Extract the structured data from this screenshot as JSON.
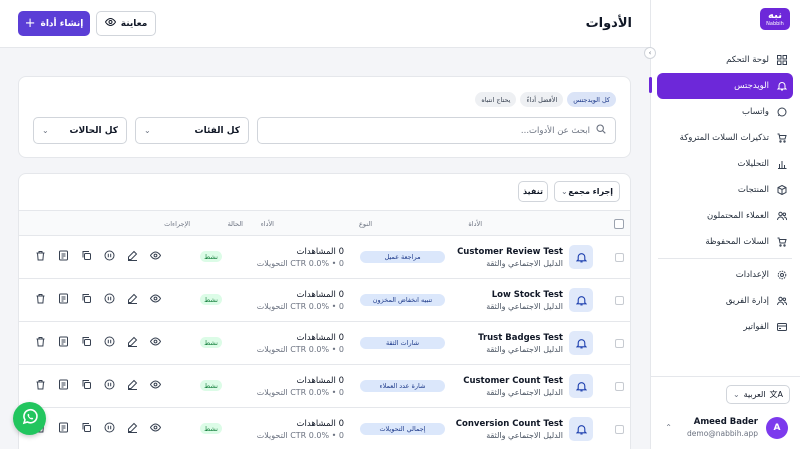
{
  "brand": {
    "logo_ar": "نبه",
    "logo_en": "Nabbih",
    "accent": "#6d28d9"
  },
  "header": {
    "title": "الأدوات",
    "create_label": "إنشاء أداة",
    "preview_label": "معاينة"
  },
  "sidebar": {
    "items": [
      {
        "label": "لوحة التحكم",
        "icon": "grid-icon"
      },
      {
        "label": "الويدجتس",
        "icon": "bell-icon",
        "active": true
      },
      {
        "label": "واتساب",
        "icon": "whatsapp-icon"
      },
      {
        "label": "تذكيرات السلات المتروكة",
        "icon": "cart-clock-icon"
      },
      {
        "label": "التحليلات",
        "icon": "bar-chart-icon"
      },
      {
        "label": "المنتجات",
        "icon": "box-icon"
      },
      {
        "label": "العملاء المحتملون",
        "icon": "users-icon"
      },
      {
        "label": "السلات المحفوظة",
        "icon": "cart-icon"
      },
      {
        "label": "الإعدادات",
        "icon": "gear-icon"
      },
      {
        "label": "إدارة الفريق",
        "icon": "team-icon"
      },
      {
        "label": "الفواتير",
        "icon": "invoice-icon"
      }
    ],
    "language": "العربية",
    "user": {
      "name": "Ameed Bader",
      "email": "demo@nabbih.app",
      "initial": "A"
    }
  },
  "filters": {
    "chips": [
      "كل الويدجتس",
      "الأفضل أداءً",
      "يحتاج انتباه"
    ],
    "search_placeholder": "ابحث عن الأدوات...",
    "category": "كل الفئات",
    "status": "كل الحالات"
  },
  "table": {
    "bulk_label": "إجراء مجمع",
    "execute_label": "تنفيذ",
    "columns": {
      "tool": "الأداة",
      "type": "النوع",
      "performance": "الأداء",
      "status": "الحالة",
      "actions": "الإجراءات"
    },
    "rows": [
      {
        "name": "Customer Review Test",
        "subtitle": "الدليل الاجتماعي والثقة",
        "type": "مراجعة عميل",
        "views": "0 المشاهدات",
        "ctr": "CTR 0.0% • 0 التحويلات",
        "status": "نشط"
      },
      {
        "name": "Low Stock Test",
        "subtitle": "الدليل الاجتماعي والثقة",
        "type": "تنبيه انخفاض المخزون",
        "views": "0 المشاهدات",
        "ctr": "CTR 0.0% • 0 التحويلات",
        "status": "نشط"
      },
      {
        "name": "Trust Badges Test",
        "subtitle": "الدليل الاجتماعي والثقة",
        "type": "شارات الثقة",
        "views": "0 المشاهدات",
        "ctr": "CTR 0.0% • 0 التحويلات",
        "status": "نشط"
      },
      {
        "name": "Customer Count Test",
        "subtitle": "الدليل الاجتماعي والثقة",
        "type": "شارة عدد العملاء",
        "views": "0 المشاهدات",
        "ctr": "CTR 0.0% • 0 التحويلات",
        "status": "نشط"
      },
      {
        "name": "Conversion Count Test",
        "subtitle": "الدليل الاجتماعي والثقة",
        "type": "إجمالي التحويلات",
        "views": "0 المشاهدات",
        "ctr": "CTR 0.0% • 0 التحويلات",
        "status": "نشط"
      }
    ]
  }
}
